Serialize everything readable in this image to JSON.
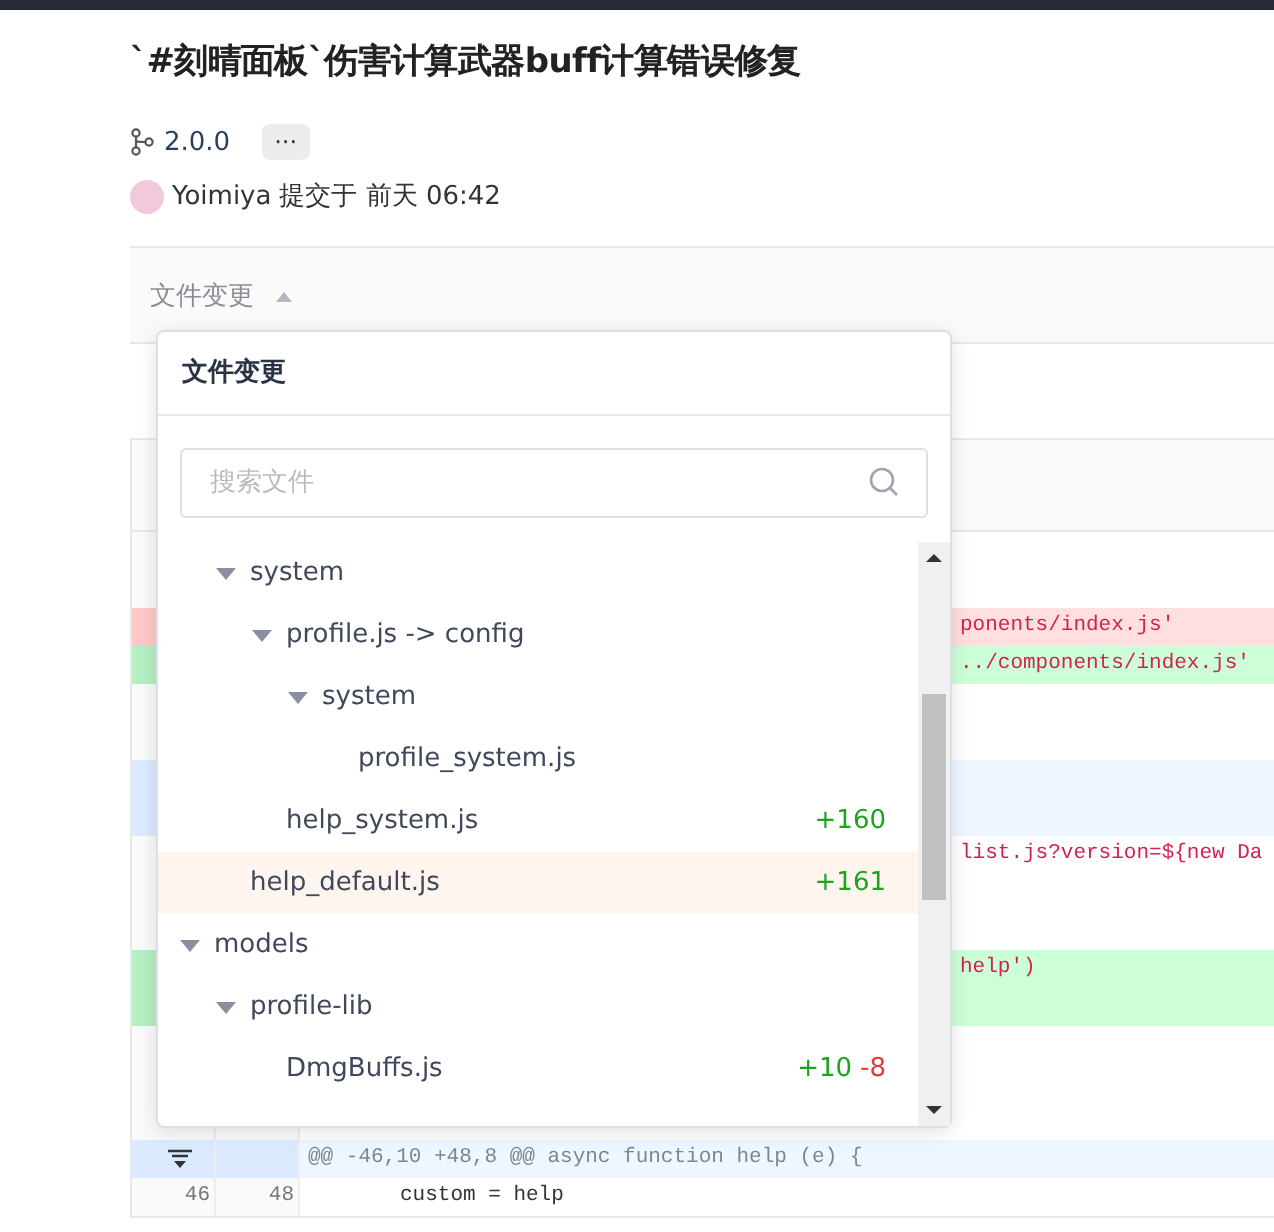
{
  "title": "`#刻晴面板`伤害计算武器buff计算错误修复",
  "version": "2.0.0",
  "more_button": "···",
  "commit": {
    "author": "Yoimiya",
    "text": "提交于 前天 06:42"
  },
  "file_changes_toggle": {
    "label": "文件变更",
    "expanded": true
  },
  "popover": {
    "title": "文件变更",
    "search": {
      "placeholder": "搜索文件"
    },
    "tree": [
      {
        "children": [
          {
            "name": "system",
            "expanded": true,
            "selected": false,
            "children": [
              {
                "name": "profile.js -> config",
                "expanded": true,
                "selected": false,
                "children": [
                  {
                    "name": "system",
                    "expanded": true,
                    "selected": false,
                    "children": [
                      {
                        "name": "profile_system.js",
                        "selected": false
                      }
                    ]
                  }
                ]
              },
              {
                "name": "help_system.js",
                "selected": false,
                "additions": "+160"
              }
            ]
          },
          {
            "name": "help_default.js",
            "selected": true,
            "additions": "+161"
          }
        ]
      },
      {
        "name": "models",
        "expanded": true,
        "selected": false,
        "children": [
          {
            "name": "profile-lib",
            "expanded": true,
            "selected": false,
            "children": [
              {
                "name": "DmgBuffs.js",
                "selected": false,
                "additions": "+10",
                "deletions": "-8"
              }
            ]
          }
        ]
      }
    ]
  },
  "diff": {
    "rows": [
      {
        "kind": "context"
      },
      {
        "kind": "context"
      },
      {
        "kind": "deleted",
        "code": "ponents/index.js'"
      },
      {
        "kind": "added",
        "code": "../components/index.js'"
      },
      {
        "kind": "context"
      },
      {
        "kind": "context"
      },
      {
        "kind": "hunk"
      },
      {
        "kind": "hunk"
      },
      {
        "kind": "context",
        "code": "list.js?version=${new Da"
      },
      {
        "kind": "context"
      },
      {
        "kind": "context"
      },
      {
        "kind": "added",
        "code": "help')"
      },
      {
        "kind": "added"
      },
      {
        "kind": "context"
      },
      {
        "kind": "context"
      },
      {
        "kind": "context"
      },
      {
        "kind": "hunk",
        "code": "@@ -46,10 +48,8 @@ async function help (e) {",
        "full": true
      },
      {
        "kind": "context",
        "old": "46",
        "new": "48",
        "code": "custom = help",
        "full": true
      }
    ]
  }
}
